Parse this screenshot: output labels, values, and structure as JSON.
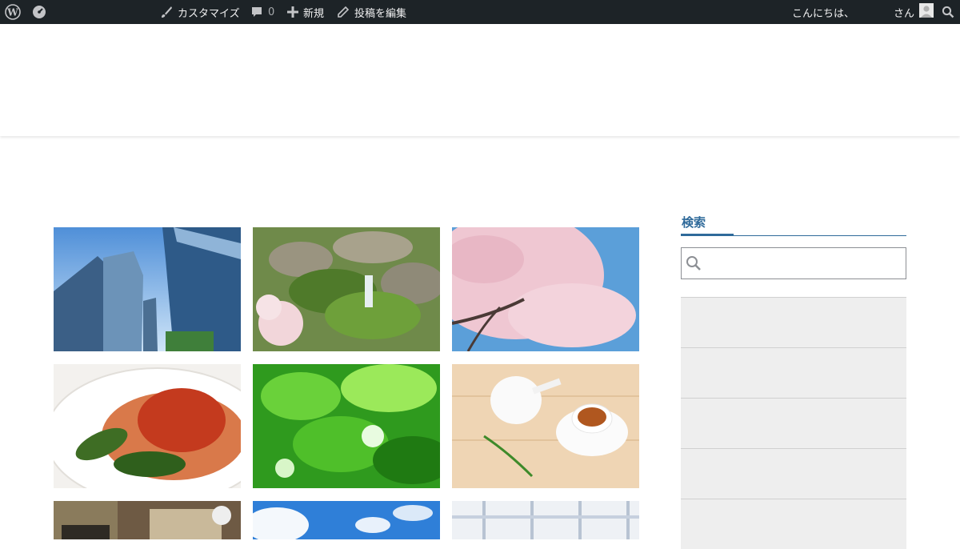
{
  "admin_bar": {
    "customize_label": "カスタマイズ",
    "comments_count": "0",
    "new_label": "新規",
    "edit_post_label": "投稿を編集",
    "greeting_prefix": "こんにちは、",
    "greeting_suffix": "さん"
  },
  "gallery": {
    "images": [
      {
        "icon": "office-buildings-photo"
      },
      {
        "icon": "mossy-stream-photo"
      },
      {
        "icon": "cherry-blossom-photo"
      },
      {
        "icon": "tomato-pasta-photo"
      },
      {
        "icon": "green-leaves-photo"
      },
      {
        "icon": "tea-cup-photo"
      },
      {
        "icon": "cafe-interior-photo"
      },
      {
        "icon": "blue-sky-clouds-photo"
      },
      {
        "icon": "checkered-cloth-photo"
      }
    ]
  },
  "sidebar": {
    "search_title": "検索",
    "search_placeholder": "",
    "items": [
      "",
      "",
      "",
      "",
      ""
    ]
  },
  "colors": {
    "admin_bar_bg": "#1d2327",
    "accent": "#2f6a9a",
    "sidebar_item_bg": "#eeeeee"
  }
}
